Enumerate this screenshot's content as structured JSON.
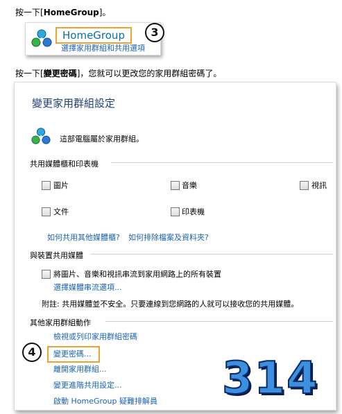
{
  "step1": {
    "instruction_prefix": "按一下[",
    "instruction_bold": "HomeGroup",
    "instruction_suffix": "]。",
    "title": "HomeGroup",
    "subtitle": "選擇家用群組和共用選項",
    "badge": "3"
  },
  "step2": {
    "instruction_prefix": "按一下[",
    "instruction_bold": "變更密碼",
    "instruction_suffix": "]，您就可以更改您的家用群組密碼了。"
  },
  "settings": {
    "heading": "變更家用群組設定",
    "membership_text": "這部電腦屬於家用群組。",
    "share_section": "共用媒體櫃和印表機",
    "checkboxes": [
      "圖片",
      "音樂",
      "視訊",
      "文件",
      "印表機"
    ],
    "link_other_libraries": "如何共用其他媒體櫃?",
    "link_exclude": "如何排除檔案及資料夾?",
    "device_section": "與裝置共用媒體",
    "stream_label": "將圖片、音樂和視訊串流到家用網路上的所有裝置",
    "stream_link": "選擇媒體串流選項...",
    "note": "附註: 共用媒體並不安全。只要連線到您網路的人就可以接收您的共用媒體。",
    "other_section": "其他家用群組動作",
    "actions": [
      "檢視或列印家用群組密碼",
      "變更密碼...",
      "離開家用群組...",
      "變更進階共用設定...",
      "啟動 HomeGroup 疑難排解員"
    ],
    "badge": "4"
  },
  "watermark": "314",
  "colors": {
    "link": "#1a63b3",
    "heading": "#1e3f78",
    "highlight": "#f0a030"
  },
  "icons": [
    "homegroup-icon"
  ]
}
